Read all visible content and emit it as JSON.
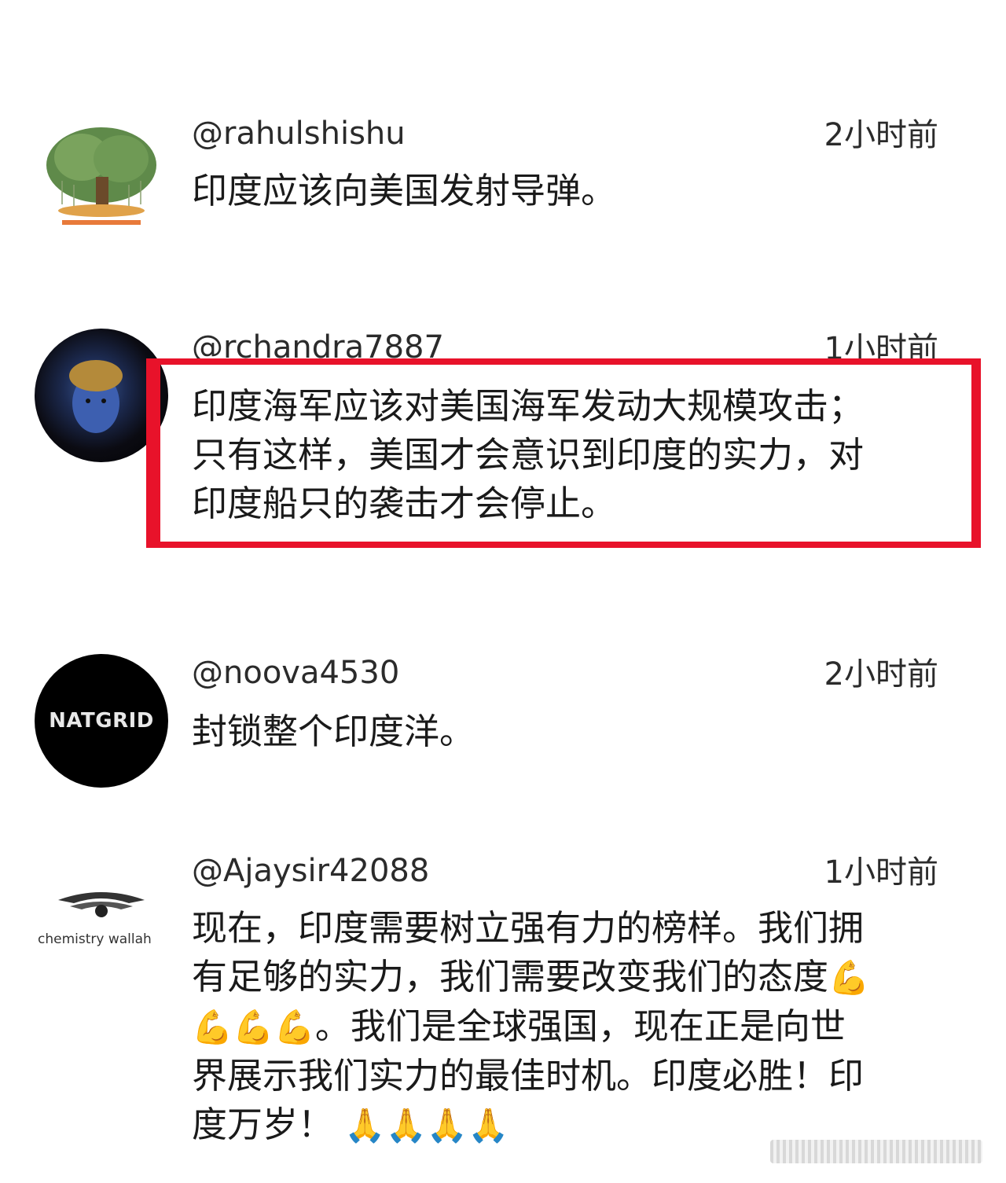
{
  "comments": [
    {
      "username": "@rahulshishu",
      "time": "2小时前",
      "text": "印度应该向美国发射导弹。",
      "avatar_icon": "tree-logo-icon"
    },
    {
      "username": "@rchandra7887",
      "time": "1小时前",
      "text_lines": [
        "印度海军应该对美国海军发动大规模攻击；",
        "只有这样，美国才会意识到印度的实力，对",
        "印度船只的袭击才会停止。"
      ],
      "avatar_icon": "portrait-icon",
      "highlight_color": "#e8122a"
    },
    {
      "username": "@noova4530",
      "time": "2小时前",
      "text": "封锁整个印度洋。",
      "avatar_label": "NATGRID"
    },
    {
      "username": "@Ajaysir42088",
      "time": "1小时前",
      "text_lines": [
        "现在，印度需要树立强有力的榜样。我们拥",
        "有足够的实力，我们需要改变我们的态度",
        "。我们是全球强国，现在正是向世",
        "界展示我们实力的最佳时机。印度必胜！印",
        "度万岁！"
      ],
      "emoji_flex": "💪",
      "emoji_pray": "🙏",
      "avatar_label": "chemistry wallah"
    }
  ]
}
